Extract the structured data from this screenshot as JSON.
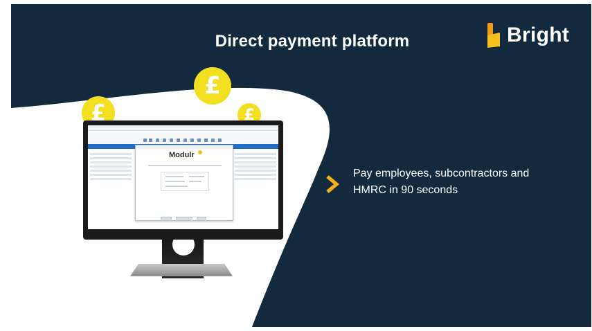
{
  "slide": {
    "title": "Direct payment platform",
    "logo_text": "Bright",
    "bullet_text": "Pay employees, subcontractors and HMRC in 90 seconds"
  },
  "coins": {
    "symbol": "£"
  },
  "monitor_screen": {
    "dialog_brand": "Modulr"
  },
  "colors": {
    "background": "#13293d",
    "accent_yellow": "#f2df1f",
    "logo_orange": "#f59b1a",
    "logo_yellow": "#f4c21a",
    "app_blue": "#1f6fc9"
  },
  "icons": [
    "bright-logo-icon",
    "chevron-right-icon",
    "pound-coin-icon"
  ]
}
